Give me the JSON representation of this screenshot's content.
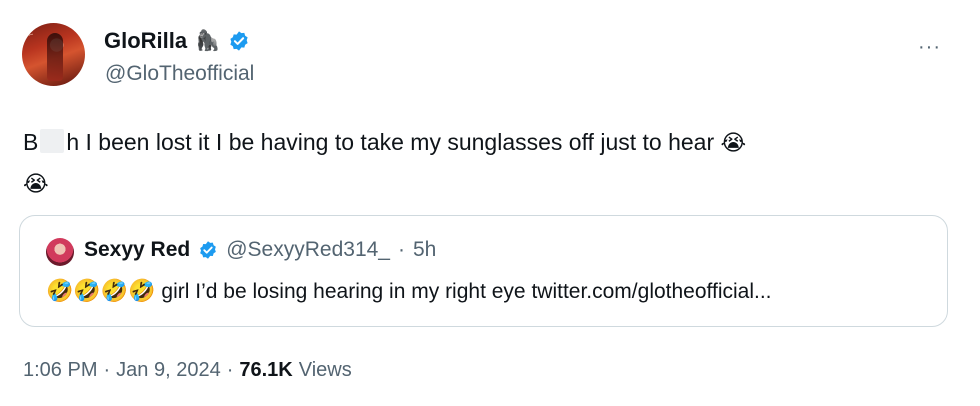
{
  "author": {
    "name": "GloRilla",
    "name_emoji": "🦍",
    "handle": "@GloTheofficial"
  },
  "more_label": "···",
  "tweet": {
    "text_start": "B",
    "text_rest": "h I been lost it I be having to take my sunglasses off just to hear",
    "emoji_1": "😭",
    "emoji_2": "😭"
  },
  "quote": {
    "name": "Sexyy Red",
    "handle": "@SexyyRed314_",
    "separator": "·",
    "time": "5h",
    "emojis": "🤣🤣🤣🤣",
    "text": "girl I’d be losing hearing in my right eye twitter.com/glotheofficial..."
  },
  "meta": {
    "time": "1:06 PM",
    "dot1": "·",
    "date": "Jan 9, 2024",
    "dot2": "·",
    "views_count": "76.1K",
    "views_label": "Views"
  },
  "colors": {
    "verified": "#1d9bf0",
    "secondary_text": "#536471",
    "border": "#cfd9de"
  }
}
